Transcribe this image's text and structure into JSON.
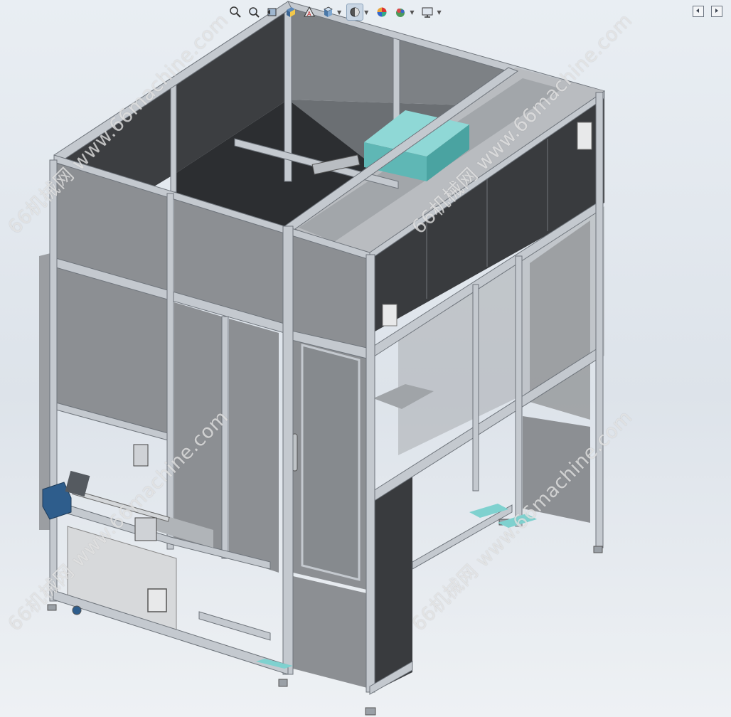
{
  "toolbar": {
    "buttons": [
      {
        "icon": "zoom-to-fit-icon"
      },
      {
        "icon": "zoom-to-area-icon"
      },
      {
        "icon": "previous-view-icon"
      },
      {
        "icon": "section-view-icon"
      },
      {
        "icon": "dynamic-annotation-icon"
      },
      {
        "icon": "view-orientation-icon"
      },
      {
        "icon": "display-style-icon",
        "active": true
      },
      {
        "icon": "hide-show-items-icon"
      },
      {
        "icon": "edit-appearance-icon"
      },
      {
        "icon": "apply-scene-icon"
      },
      {
        "icon": "view-settings-icon"
      }
    ]
  },
  "watermarks": {
    "w1": "66机械网 www.66machine.com",
    "w2": "66机械网 www.66machine.com",
    "w3": "66机械网 www.66machine.com",
    "w4": "66机械网 www.66machine.com"
  },
  "colors": {
    "frame": "#c4c9cf",
    "frame_dark": "#6e747b",
    "panel_gray": "#8c8f93",
    "panel_dark": "#3b3d40",
    "panel_light": "#b7babd",
    "teal": "#6cc6c4",
    "motor_blue": "#2e5d8c"
  }
}
